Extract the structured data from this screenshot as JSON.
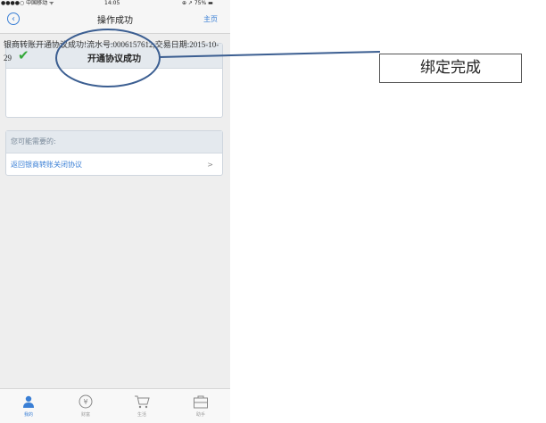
{
  "status_bar": {
    "carrier": "●●●●○ 中国移动 ᯤ",
    "time": "14:05",
    "battery": "⊕ ↗ 75% ▬"
  },
  "nav": {
    "title": "操作成功",
    "home": "主页"
  },
  "result": {
    "title": "开通协议成功",
    "message": "银商转账开通协议成功!流水号:0006157612,交易日期:2015-10-29"
  },
  "suggestions": {
    "header": "您可能需要的:",
    "items": [
      {
        "label": "返回银商转账关闭协议",
        "chevron": ">"
      }
    ]
  },
  "tabbar": {
    "items": [
      {
        "label": "我的",
        "icon": "person-icon"
      },
      {
        "label": "财富",
        "icon": "yen-icon"
      },
      {
        "label": "生活",
        "icon": "cart-icon"
      },
      {
        "label": "助手",
        "icon": "briefcase-icon"
      }
    ]
  },
  "annotation": {
    "callout": "绑定完成"
  },
  "colors": {
    "accent": "#3a7fd5",
    "success": "#35a83a",
    "annotation": "#3b5e91"
  }
}
